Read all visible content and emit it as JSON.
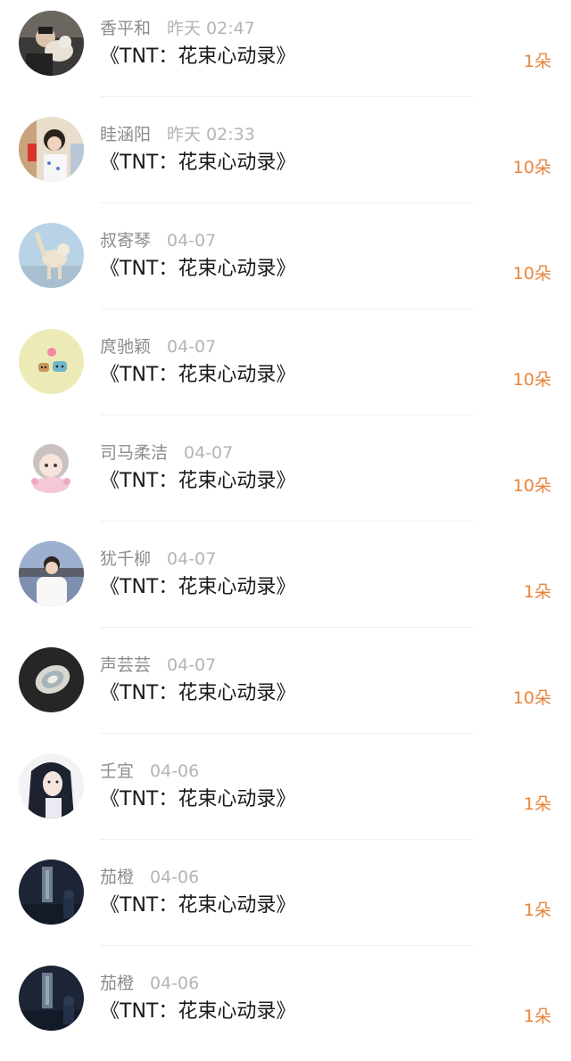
{
  "colors": {
    "name": "#8c8c8c",
    "time": "#b4b4b4",
    "title": "#1a1a1a",
    "count": "#e8843a",
    "divider": "#f0f0f0"
  },
  "rows": [
    {
      "name": "香平和",
      "time": "昨天 02:47",
      "title": "《TNT：花束心动录》",
      "count": "1朵",
      "avatar_icon": "person-with-pet-avatar"
    },
    {
      "name": "眭涵阳",
      "time": "昨天 02:33",
      "title": "《TNT：花束心动录》",
      "count": "10朵",
      "avatar_icon": "girl-photo-avatar"
    },
    {
      "name": "叔寄琴",
      "time": "04-07",
      "title": "《TNT：花束心动录》",
      "count": "10朵",
      "avatar_icon": "dog-avatar"
    },
    {
      "name": "庹驰颖",
      "time": "04-07",
      "title": "《TNT：花束心动录》",
      "count": "10朵",
      "avatar_icon": "cute-bowls-avatar"
    },
    {
      "name": "司马柔洁",
      "time": "04-07",
      "title": "《TNT：花束心动录》",
      "count": "10朵",
      "avatar_icon": "anime-chibi-avatar"
    },
    {
      "name": "犹千柳",
      "time": "04-07",
      "title": "《TNT：花束心动录》",
      "count": "1朵",
      "avatar_icon": "boy-white-shirt-avatar"
    },
    {
      "name": "声芸芸",
      "time": "04-07",
      "title": "《TNT：花束心动录》",
      "count": "10朵",
      "avatar_icon": "shell-avatar"
    },
    {
      "name": "壬宜",
      "time": "04-06",
      "title": "《TNT：花束心动录》",
      "count": "1朵",
      "avatar_icon": "anime-portrait-avatar"
    },
    {
      "name": "茄橙",
      "time": "04-06",
      "title": "《TNT：花束心动录》",
      "count": "1朵",
      "avatar_icon": "dark-room-avatar"
    },
    {
      "name": "茄橙",
      "time": "04-06",
      "title": "《TNT：花束心动录》",
      "count": "1朵",
      "avatar_icon": "dark-room-avatar"
    }
  ]
}
